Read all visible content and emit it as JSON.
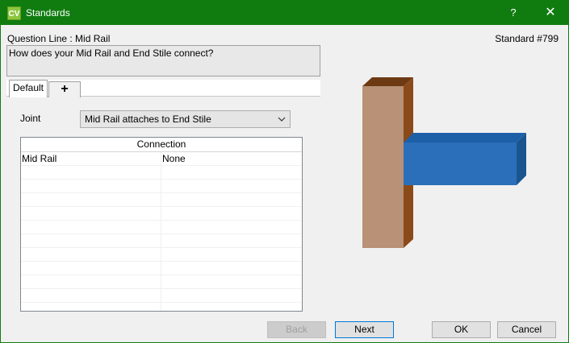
{
  "window": {
    "app_icon_text": "CV",
    "title": "Standards",
    "help": "?",
    "close": "✕"
  },
  "question": {
    "label": "Question Line : Mid Rail",
    "standard": "Standard #799",
    "text": "How does your Mid Rail and End Stile connect?"
  },
  "tabs": [
    {
      "label": "Default"
    },
    {
      "label": "+"
    }
  ],
  "joint": {
    "label": "Joint",
    "selected": "Mid Rail attaches to End Stile"
  },
  "grid": {
    "header": "Connection",
    "rows": [
      {
        "part": "Mid Rail",
        "connection": "None"
      }
    ]
  },
  "buttons": {
    "back": "Back",
    "next": "Next",
    "ok": "OK",
    "cancel": "Cancel"
  },
  "colors": {
    "titlebar": "#107c10",
    "stile_front": "#b89176",
    "stile_side": "#8b4a1a",
    "rail_front": "#2b6fba",
    "rail_side": "#1a5590"
  }
}
